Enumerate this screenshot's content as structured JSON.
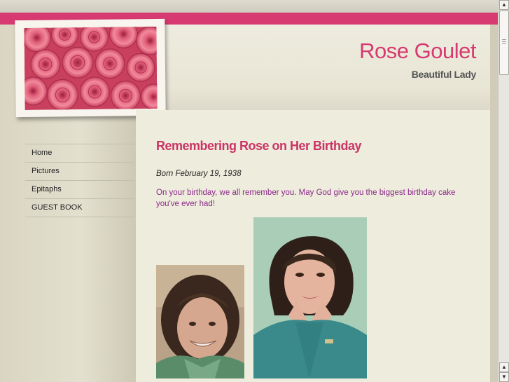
{
  "site": {
    "title": "Rose Goulet",
    "subtitle": "Beautiful Lady"
  },
  "nav": {
    "items": [
      {
        "label": "Home"
      },
      {
        "label": "Pictures"
      },
      {
        "label": "Epitaphs"
      },
      {
        "label": "GUEST BOOK"
      }
    ]
  },
  "content": {
    "heading": "Remembering Rose on Her Birthday",
    "born": "Born February 19, 1938",
    "message": "On your birthday, we all remember you. May God give you the biggest birthday cake you've ever had!"
  },
  "colors": {
    "accent": "#d63a70",
    "heading": "#cc3366",
    "message": "#8a2a8a",
    "background": "#eeecdc"
  },
  "icons": {
    "scroll_up": "arrow-up-icon",
    "scroll_down": "arrow-down-icon"
  }
}
